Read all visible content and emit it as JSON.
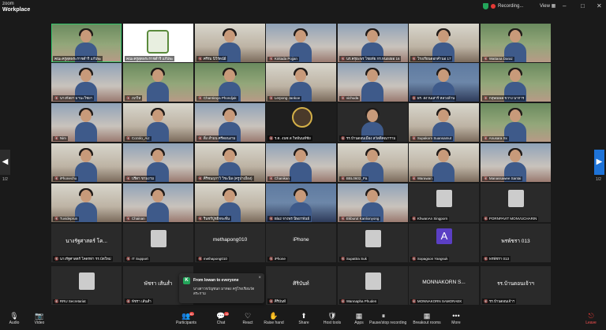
{
  "app": {
    "logo_line1": "zoom",
    "logo_line2": "Workplace"
  },
  "status": {
    "recording": "Recording...",
    "view": "View"
  },
  "window": {
    "minimize": "–",
    "maximize": "□",
    "close": "✕"
  },
  "pager": {
    "left": "1/2",
    "right": "1/2"
  },
  "tiles": [
    {
      "name": "คณะครูสุดพระราชดำริ แก๊ปพะ",
      "style": "cam"
    },
    {
      "name": "คณะครูสุดพระราชดำริ แก๊ปพะ",
      "style": "logo"
    },
    {
      "name": "🔇 ศรีร่ม นิวิรัตน์ฝ์",
      "style": "cam b3"
    },
    {
      "name": "🔇 Kiritada Pojjan",
      "style": "cam b2"
    },
    {
      "name": "🔇 นร.ครุยะพร ไชยทัย กร.หนองผอ 16",
      "style": "cam b2"
    },
    {
      "name": "🔇 โรงเรียนดอกคำนอ 17",
      "style": "cam b3"
    },
    {
      "name": "🔇 Wattana Daraz",
      "style": "cam"
    },
    {
      "name": "🔇 นางกัลยา มานะวิชยา",
      "style": "cam b2"
    },
    {
      "name": "🔇 ภภวิห",
      "style": "cam"
    },
    {
      "name": "🔇 Chantiraya Phondjak",
      "style": "cam"
    },
    {
      "name": "🔇 Lerpong Jankoe",
      "style": "cam b3"
    },
    {
      "name": "🔇 vichuda",
      "style": "cam b2"
    },
    {
      "name": "🔇 ผร. สงวนเสาร์ หลวงล้าน",
      "style": "cam b4"
    },
    {
      "name": "🔇 กฤษณพล ขวาง นาการ",
      "style": "cam"
    },
    {
      "name": "🔇 Nim",
      "style": "cam b2"
    },
    {
      "name": "🔇 Cozolo_Aiz",
      "style": "cam b3"
    },
    {
      "name": "🔇 ติ่ง สำมน ศรีดอนงาม",
      "style": "cam b2"
    },
    {
      "name": "🔇 ร.ต. 4นซ ส.วิทย์นนท์ชัย",
      "style": "dark"
    },
    {
      "name": "🔇 รร.บ้านดอนเมือง สวัสดิคณาราม",
      "style": "camoff"
    },
    {
      "name": "🔇 Supakorn Suansamut",
      "style": "cam b3"
    },
    {
      "name": "🔇 Anusara Sx",
      "style": "cam"
    },
    {
      "name": "🔇 iPhonechu",
      "style": "cam b3"
    },
    {
      "name": "🔇 ปรีดา ขามงาม",
      "style": "cam b2"
    },
    {
      "name": "🔇 ศิริชนฤภาวิ วิชะนิล (ครูป่าเมือง)",
      "style": "cam b3"
    },
    {
      "name": "🔇 Chanikan",
      "style": "cam b2"
    },
    {
      "name": "🔇 BBL0602_Pa",
      "style": "cam b3"
    },
    {
      "name": "🔇 Warawan",
      "style": "cam b3"
    },
    {
      "name": "🔇 Manassawee Santai",
      "style": "cam b2"
    },
    {
      "name": "🔇 Tuvideprun",
      "style": "cam b3"
    },
    {
      "name": "🔇 Chainan",
      "style": "cam b2"
    },
    {
      "name": "🔇 รินชร์ปู่ชยิจจะพี่น",
      "style": "cam b3"
    },
    {
      "name": "🔇 Bla2 จางพร นิพยาพันธ์",
      "style": "cam b4"
    },
    {
      "name": "🔇 Ekburut Kanlionyong",
      "style": "cam b2"
    },
    {
      "name": "🔇 KhwanAn Singporn",
      "style": "thumb"
    },
    {
      "name": "🔇 PORNPAVIT MONVUCHARIN",
      "style": "thumb"
    },
    {
      "name": "🔇 นางรัฐศาสตร์ โคตรท่า รร.บัดใหม่",
      "big": "นางรัฐศาสตร์ โค...",
      "style": "namecard"
    },
    {
      "name": "🔇 IT Support",
      "style": "thumb"
    },
    {
      "name": "🔇 methapong010",
      "big": "methapong010",
      "style": "namecard"
    },
    {
      "name": "🔇 iPhone",
      "big": "iPhone",
      "style": "namecard"
    },
    {
      "name": "🔇 Supattra Suk",
      "style": "thumb"
    },
    {
      "name": "🔇 Sopagson Yangsuk",
      "big": "A",
      "style": "avatarA"
    },
    {
      "name": "🔇 พรพัชรา 013",
      "big": "พรพัชรา 013",
      "style": "namecard"
    },
    {
      "name": "🔇 RRU Secretariat",
      "style": "thumb"
    },
    {
      "name": "🔇 พัชรา เส้นสำ",
      "big": "พัชรา เส้นส่ำ",
      "style": "namecard"
    },
    {
      "name": "",
      "style": "empty"
    },
    {
      "name": "🔇 ศิริบันท์",
      "big": "ศิริบันท์",
      "style": "namecard"
    },
    {
      "name": "🔇 Wannapha Phuden",
      "style": "thumb"
    },
    {
      "name": "🔇 MONNAKORN SAMORAEK",
      "big": "MONNAKORN S...",
      "style": "namecard"
    },
    {
      "name": "🔇 รร.บ้านดอนเจ้าฯ",
      "big": "รร.บ้านดอนเจ้าฯ",
      "style": "namecard"
    }
  ],
  "chat_toast": {
    "from": "From lowan to everyone",
    "message": "นางสาวขวัญชนก มาทอง ครูโรงเรียนวัดสระกาม",
    "close": "×"
  },
  "toolbar": [
    {
      "label": "Audio",
      "icon": "🎙"
    },
    {
      "label": "Video",
      "icon": "📷"
    },
    {
      "label": "Participants",
      "icon": "👥",
      "badge": "81"
    },
    {
      "label": "Chat",
      "icon": "💬",
      "badge": "16"
    },
    {
      "label": "React",
      "icon": "♡"
    },
    {
      "label": "Raise hand",
      "icon": "✋"
    },
    {
      "label": "Share",
      "icon": "⬆"
    },
    {
      "label": "Host tools",
      "icon": "🛡"
    },
    {
      "label": "Apps",
      "icon": "▦"
    },
    {
      "label": "Pause/stop recording",
      "icon": "⏸"
    },
    {
      "label": "Breakout rooms",
      "icon": "▦"
    },
    {
      "label": "More",
      "icon": "•••"
    },
    {
      "label": "Leave",
      "icon": "⎋"
    }
  ]
}
